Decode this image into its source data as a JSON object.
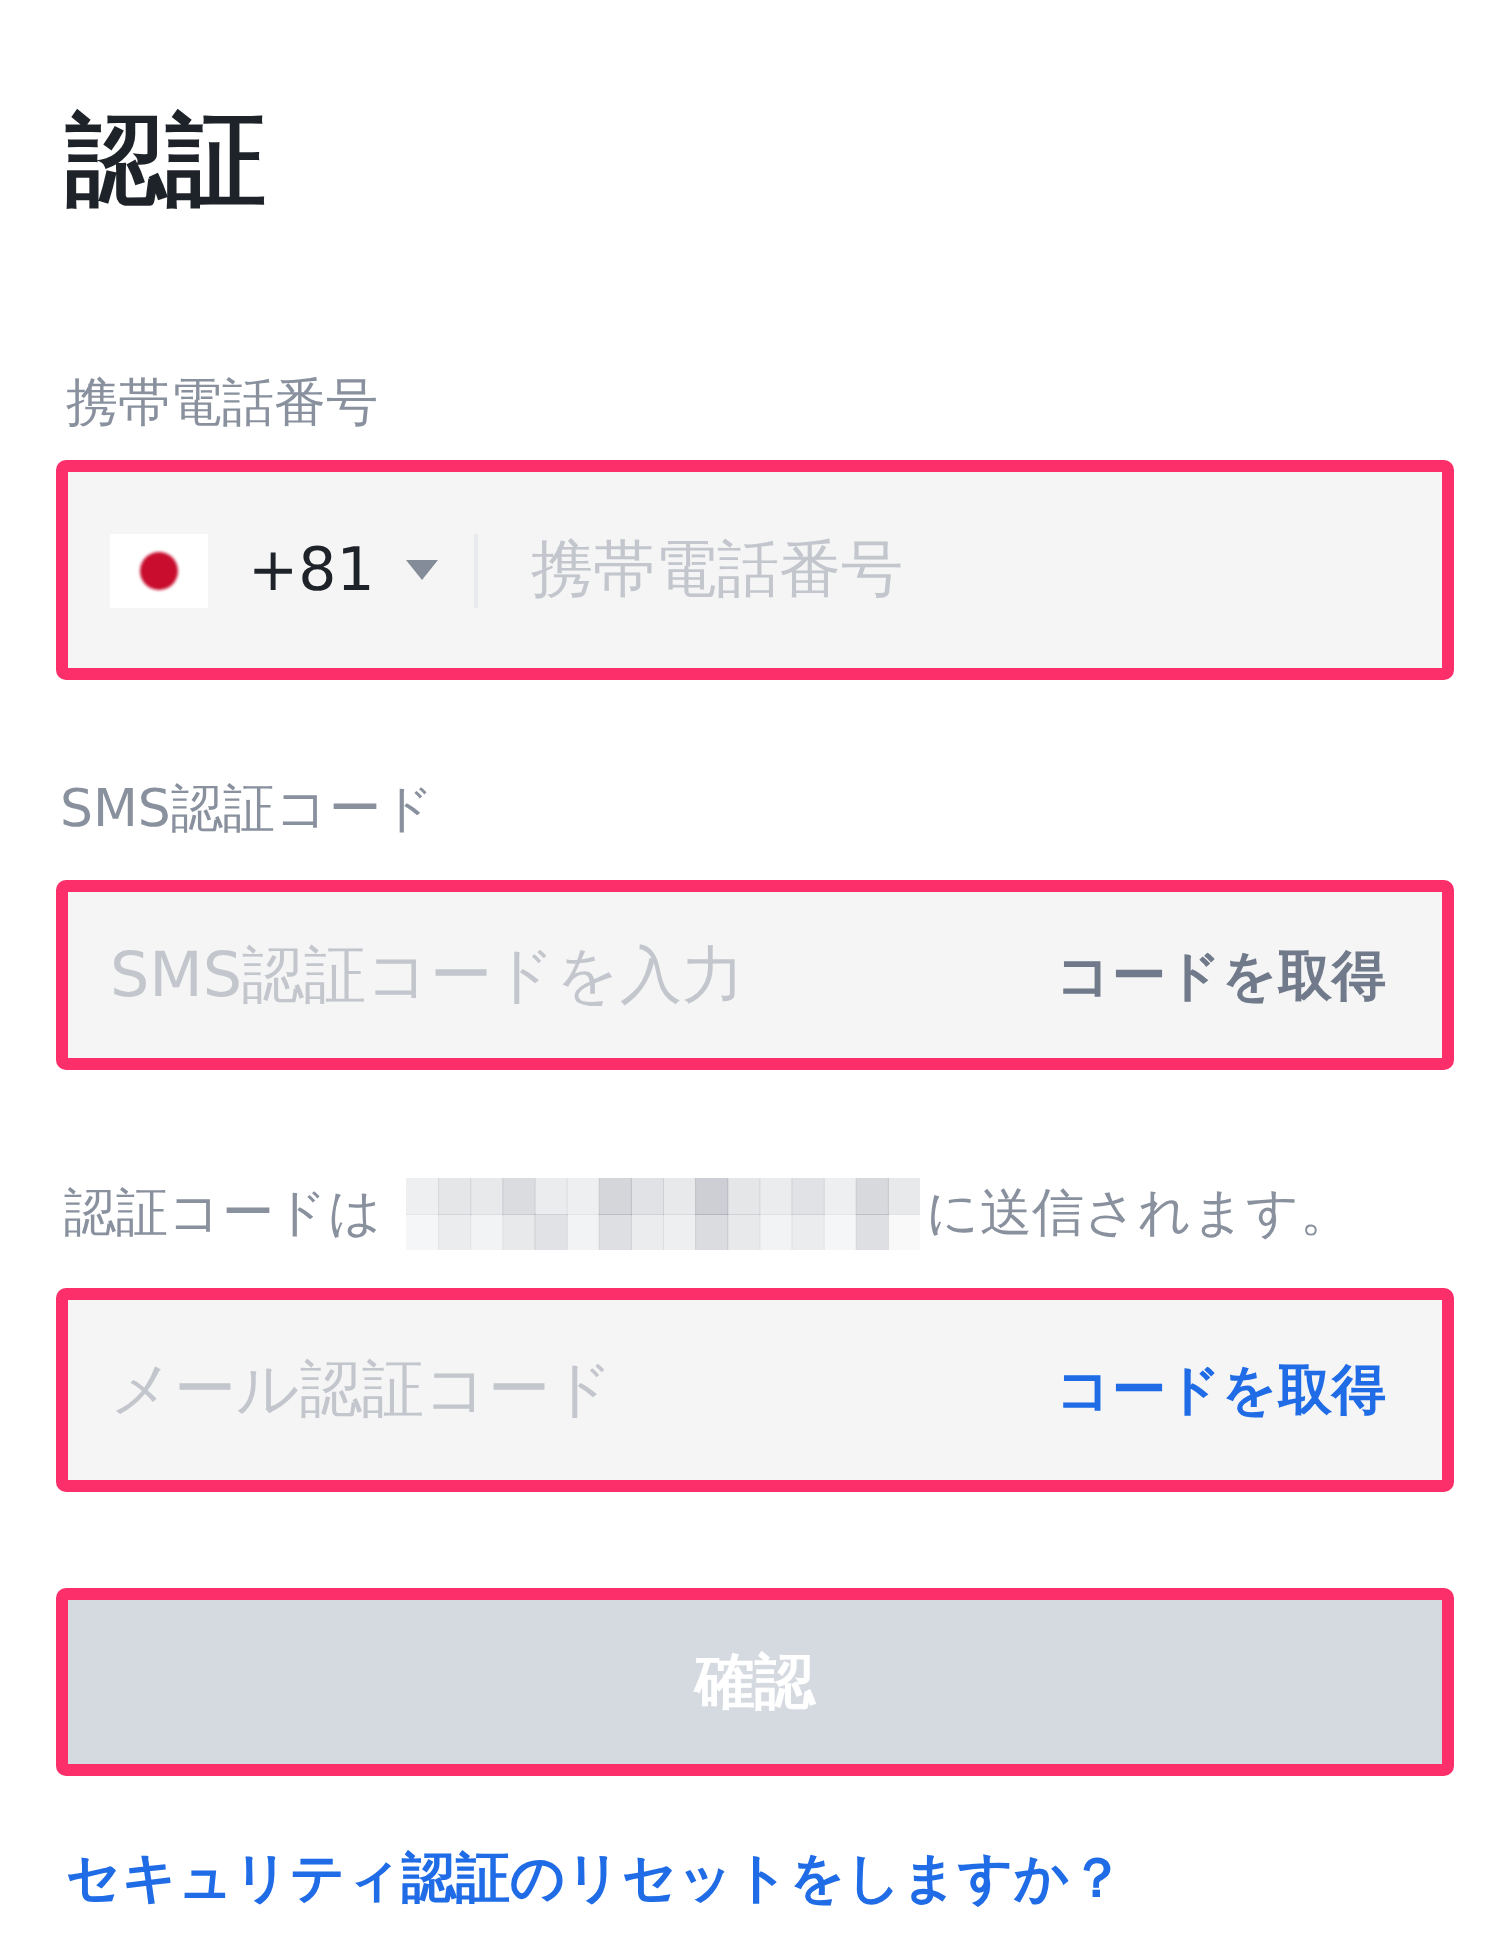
{
  "title": "認証",
  "phone": {
    "label": "携帯電話番号",
    "country_code": "+81",
    "placeholder": "携帯電話番号",
    "highlighted": true
  },
  "sms": {
    "label": "SMS認証コード",
    "placeholder": "SMS認証コードを入力",
    "highlighted": true,
    "action": {
      "label": "コードを取得",
      "disabled": true
    }
  },
  "email_hint": {
    "before": "認証コードは",
    "after": "に送信されます。"
  },
  "email": {
    "placeholder": "メール認証コード",
    "highlighted": true,
    "action": {
      "label": "コードを取得",
      "disabled": false
    }
  },
  "submit": {
    "label": "確認",
    "disabled": true,
    "highlighted": true
  },
  "reset_link": "セキュリティ認証のリセットをしますか？"
}
